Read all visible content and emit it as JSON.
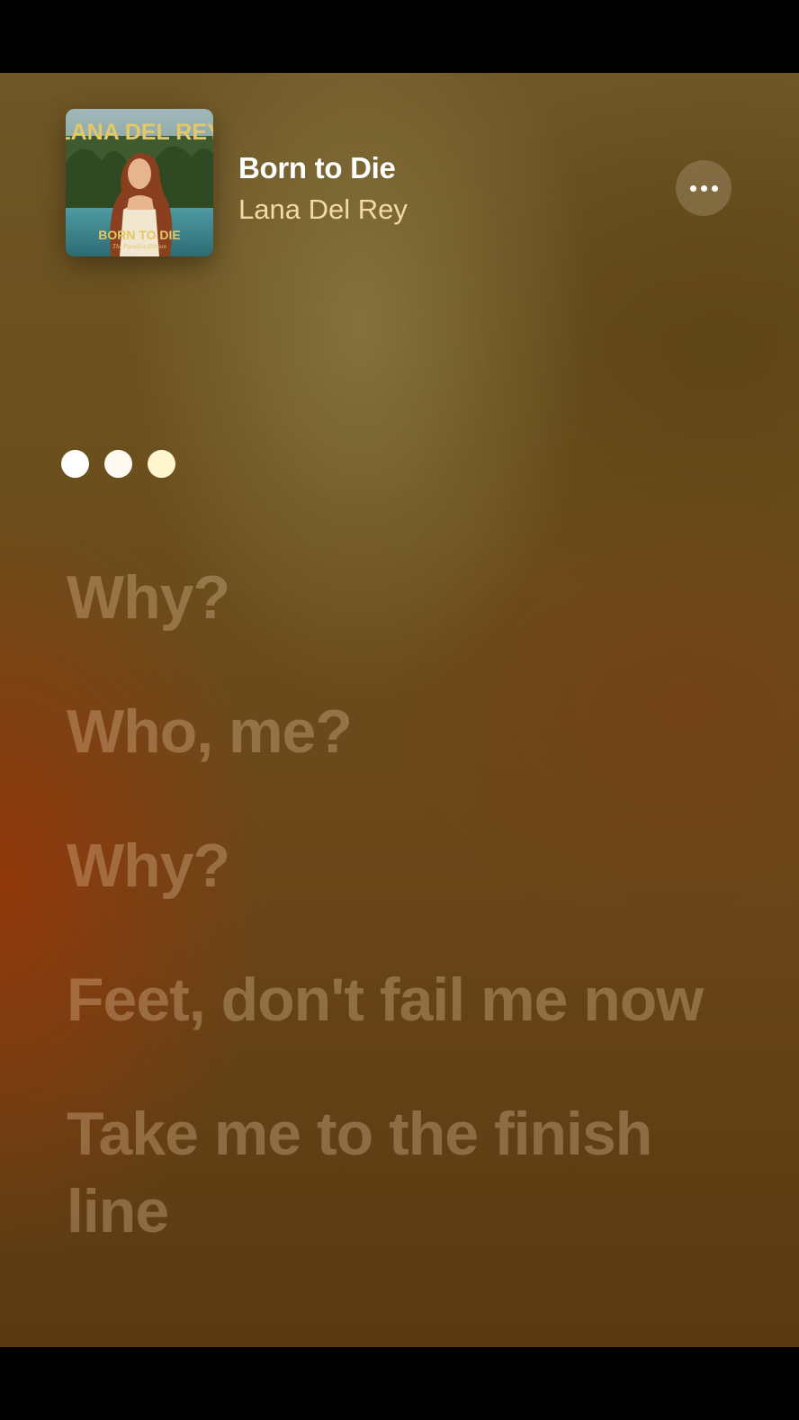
{
  "now_playing": {
    "title": "Born to Die",
    "artist": "Lana Del Rey",
    "album_art": {
      "icon": "album-cover",
      "cover_text_top": "LANA DEL REY",
      "cover_text_bottom": "BORN TO DIE",
      "cover_subtitle": "The Paradise Edition"
    },
    "more_icon": "ellipsis-icon"
  },
  "interlude": {
    "dot_colors": [
      "#ffffff",
      "#fffaf0",
      "#fff6d0"
    ]
  },
  "lyrics": {
    "lines": [
      "Why?",
      "Who, me?",
      "Why?",
      "Feet, don't fail me now",
      "Take me to the finish line"
    ]
  },
  "colors": {
    "title": "#ffffff",
    "artist": "#f3d9a6",
    "lyric_inactive": "rgba(255,225,185,0.28)"
  }
}
